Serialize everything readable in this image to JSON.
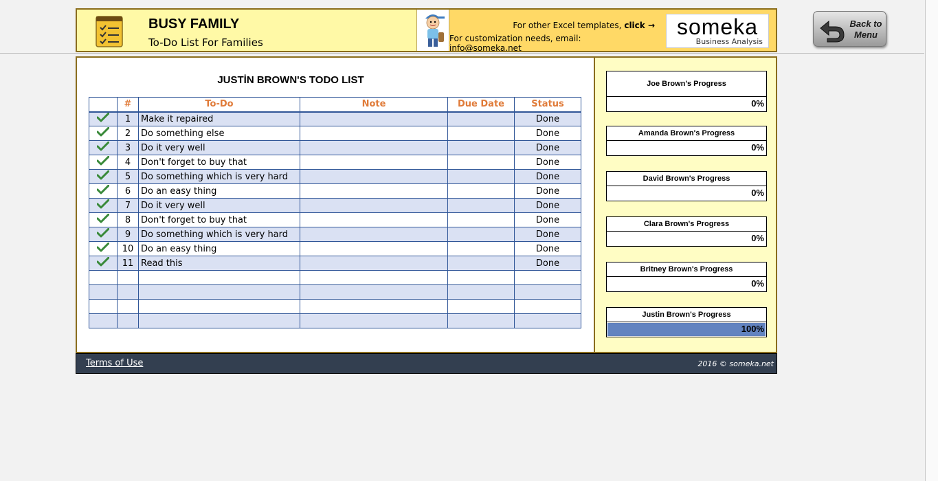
{
  "header": {
    "title": "BUSY FAMILY",
    "subtitle": "To-Do List For Families",
    "promo_prefix": "For other Excel templates,",
    "promo_link": "click →",
    "promo_email": "For customization needs, email: info@someka.net",
    "logo_text": "someka",
    "logo_sub": "Business Analysis",
    "back_button": "Back to Menu"
  },
  "list": {
    "title": "JUSTİN BROWN'S TODO LIST",
    "columns": [
      "#",
      "To-Do",
      "Note",
      "Due Date",
      "Status"
    ],
    "rows": [
      {
        "num": "1",
        "todo": "Make it repaired",
        "note": "",
        "due": "",
        "status": "Done",
        "checked": true
      },
      {
        "num": "2",
        "todo": "Do something else",
        "note": "",
        "due": "",
        "status": "Done",
        "checked": true
      },
      {
        "num": "3",
        "todo": "Do it very well",
        "note": "",
        "due": "",
        "status": "Done",
        "checked": true
      },
      {
        "num": "4",
        "todo": "Don't forget to buy that",
        "note": "",
        "due": "",
        "status": "Done",
        "checked": true
      },
      {
        "num": "5",
        "todo": "Do something which is very hard",
        "note": "",
        "due": "",
        "status": "Done",
        "checked": true
      },
      {
        "num": "6",
        "todo": "Do an easy thing",
        "note": "",
        "due": "",
        "status": "Done",
        "checked": true
      },
      {
        "num": "7",
        "todo": "Do it very well",
        "note": "",
        "due": "",
        "status": "Done",
        "checked": true
      },
      {
        "num": "8",
        "todo": "Don't forget to buy that",
        "note": "",
        "due": "",
        "status": "Done",
        "checked": true
      },
      {
        "num": "9",
        "todo": "Do something which is very hard",
        "note": "",
        "due": "",
        "status": "Done",
        "checked": true
      },
      {
        "num": "10",
        "todo": "Do an easy thing",
        "note": "",
        "due": "",
        "status": "Done",
        "checked": true
      },
      {
        "num": "11",
        "todo": "Read this",
        "note": "",
        "due": "",
        "status": "Done",
        "checked": true
      },
      {
        "num": "",
        "todo": "",
        "note": "",
        "due": "",
        "status": "",
        "checked": false
      },
      {
        "num": "",
        "todo": "",
        "note": "",
        "due": "",
        "status": "",
        "checked": false
      },
      {
        "num": "",
        "todo": "",
        "note": "",
        "due": "",
        "status": "",
        "checked": false
      },
      {
        "num": "",
        "todo": "",
        "note": "",
        "due": "",
        "status": "",
        "checked": false
      }
    ]
  },
  "progress": [
    {
      "name": "Joe Brown's Progress",
      "value": "0%",
      "fraction": 0
    },
    {
      "name": "Amanda Brown's Progress",
      "value": "0%",
      "fraction": 0
    },
    {
      "name": "David Brown's Progress",
      "value": "0%",
      "fraction": 0
    },
    {
      "name": "Clara Brown's Progress",
      "value": "0%",
      "fraction": 0
    },
    {
      "name": "Britney Brown's Progress",
      "value": "0%",
      "fraction": 0
    },
    {
      "name": "Justin Brown's Progress",
      "value": "100%",
      "fraction": 1
    }
  ],
  "footer": {
    "terms": "Terms of Use",
    "copyright": "2016 © someka.net"
  },
  "colors": {
    "accent_orange": "#e07b39",
    "table_border": "#2f5597",
    "row_alt": "#dae1f3",
    "check_green": "#3a8a3a",
    "progress_fill": "#6283c0",
    "footer_bg": "#333f50"
  },
  "icons": {
    "list": "notepad-checklist-icon",
    "mascot": "kid-mascot-icon",
    "back": "back-arrow-icon",
    "check": "checkmark-icon"
  }
}
